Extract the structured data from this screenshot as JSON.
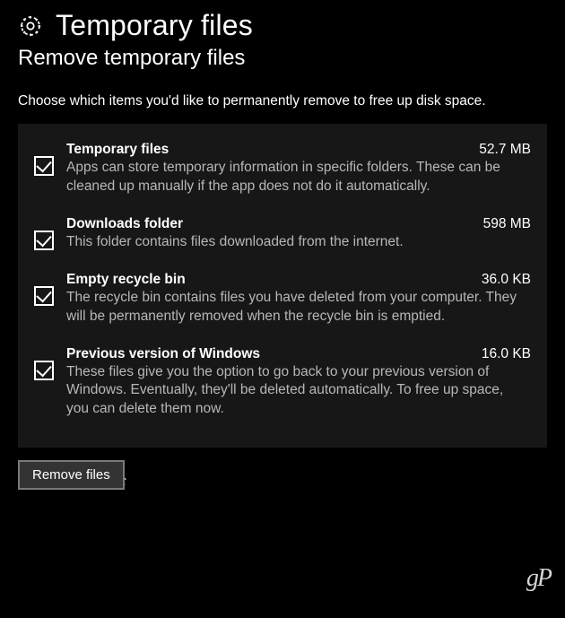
{
  "header": {
    "title": "Temporary files",
    "subtitle": "Remove temporary files",
    "instruction": "Choose which items you'd like to permanently remove to free up disk space."
  },
  "items": [
    {
      "title": "Temporary files",
      "size": "52.7 MB",
      "desc": "Apps can store temporary information in specific folders. These can be cleaned up manually if the app does not do it automatically."
    },
    {
      "title": "Downloads folder",
      "size": "598 MB",
      "desc": "This folder contains files downloaded from the internet."
    },
    {
      "title": "Empty recycle bin",
      "size": "36.0 KB",
      "desc": "The recycle bin contains files you have deleted from your computer. They will be permanently removed when the recycle bin is emptied."
    },
    {
      "title": "Previous version of Windows",
      "size": "16.0 KB",
      "desc": "These files give you the option to go back to your previous version of Windows. Eventually, they'll be deleted automatically. To free up space, you can delete them now."
    }
  ],
  "footer": {
    "remove_label": "Remove files"
  },
  "logo": "gP"
}
